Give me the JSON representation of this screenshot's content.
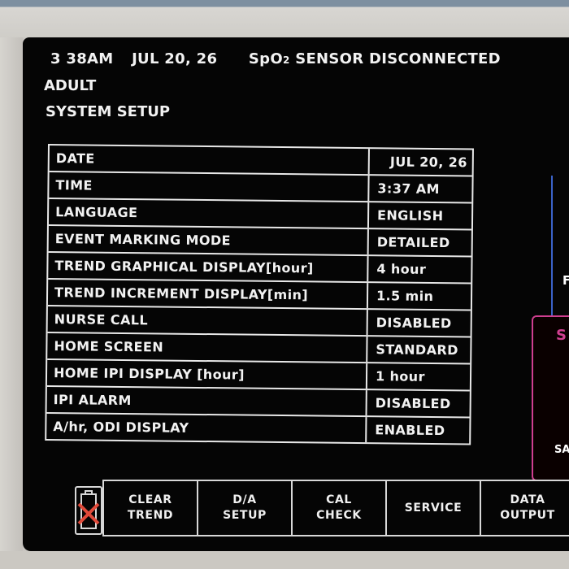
{
  "status": {
    "time": "3 38AM",
    "date": "JUL 20, 26",
    "alarm": "SpO2 SENSOR DISCONNECTED"
  },
  "mode": "ADULT",
  "title": "SYSTEM SETUP",
  "settings": [
    {
      "label": "DATE",
      "value": "JUL 20, 26"
    },
    {
      "label": "TIME",
      "value": "3:37 AM"
    },
    {
      "label": "LANGUAGE",
      "value": "ENGLISH"
    },
    {
      "label": "EVENT MARKING MODE",
      "value": "DETAILED"
    },
    {
      "label": "TREND GRAPHICAL DISPLAY[hour]",
      "value": "4 hour"
    },
    {
      "label": "TREND INCREMENT DISPLAY[min]",
      "value": "1.5 min"
    },
    {
      "label": "NURSE CALL",
      "value": "DISABLED"
    },
    {
      "label": "HOME SCREEN",
      "value": "STANDARD"
    },
    {
      "label": "HOME IPI DISPLAY [hour]",
      "value": "1 hour"
    },
    {
      "label": "IPI ALARM",
      "value": "DISABLED"
    },
    {
      "label": "A/hr, ODI DISPLAY",
      "value": "ENABLED"
    }
  ],
  "side_fragments": {
    "blue_panel": "F",
    "pink_panel_top": "S",
    "pink_panel_bottom": "SA"
  },
  "softkeys": [
    {
      "label": "CLEAR\nTREND"
    },
    {
      "label": "D/A\nSETUP"
    },
    {
      "label": "CAL\nCHECK"
    },
    {
      "label": "SERVICE"
    },
    {
      "label": "DATA\nOUTPUT"
    }
  ],
  "icons": {
    "battery": "battery-disconnected-icon"
  },
  "colors": {
    "screen_bg": "#050505",
    "text": "#f2f2f2",
    "accent_blue": "#3b63c9",
    "accent_pink": "#cf3f90",
    "battery_x": "#e04a3a"
  }
}
